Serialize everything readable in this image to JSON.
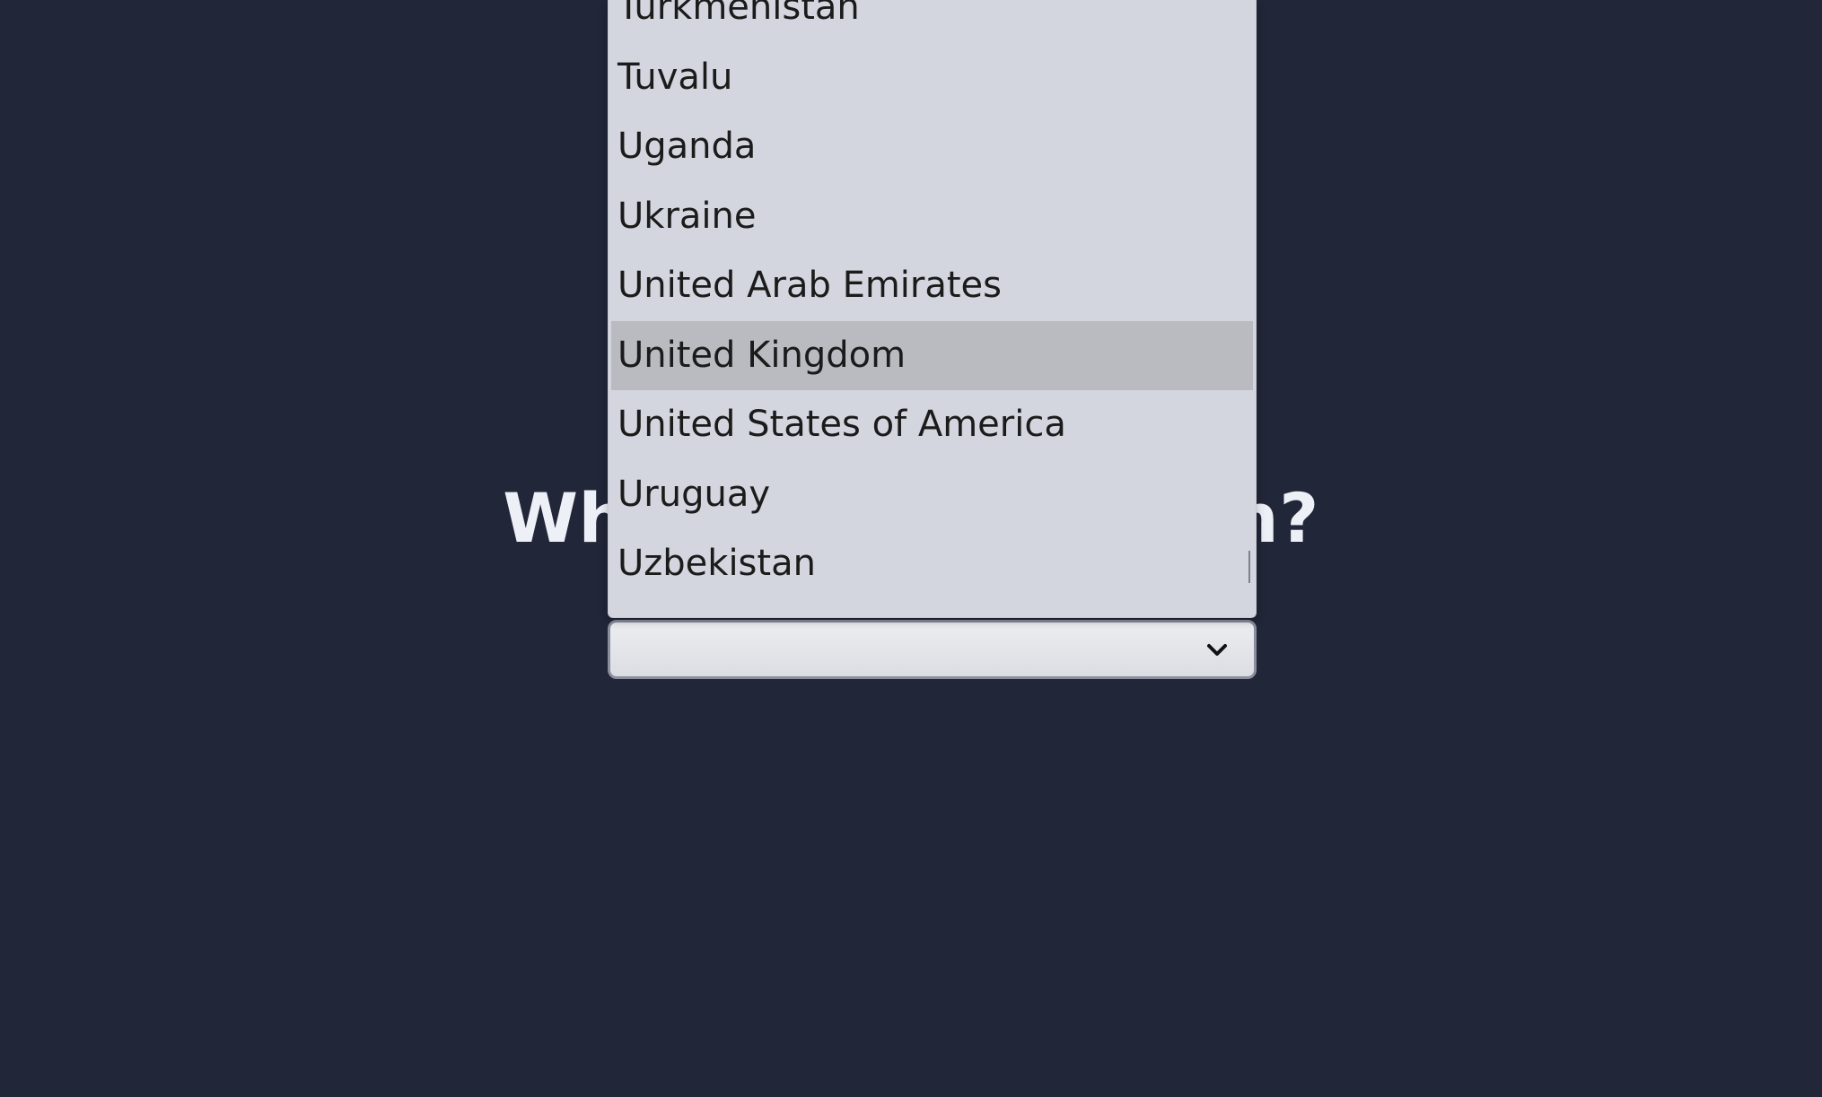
{
  "question": {
    "text": "Where are you from?"
  },
  "country_select": {
    "selected_value": ""
  },
  "dropdown": {
    "options": [
      "Turkmenistan",
      "Tuvalu",
      "Uganda",
      "Ukraine",
      "United Arab Emirates",
      "United Kingdom",
      "United States of America",
      "Uruguay",
      "Uzbekistan"
    ],
    "highlighted_option": "United Kingdom"
  },
  "colors": {
    "page_background": "#212638",
    "dropdown_background": "#d3d6de",
    "highlight": "#b9bbc1",
    "heading_text": "#eef0f7"
  },
  "icons": {
    "select_arrow": "chevron-down-icon"
  }
}
